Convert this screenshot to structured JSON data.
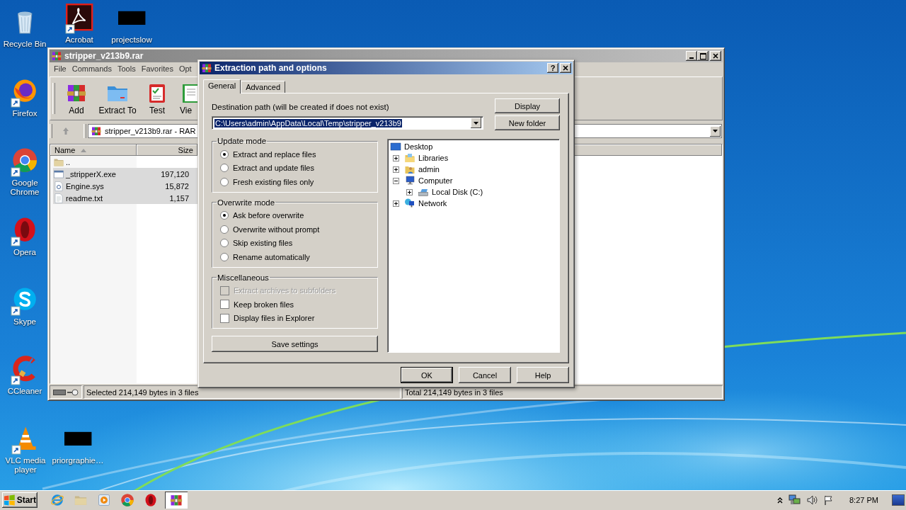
{
  "desktop_icons": [
    {
      "label": "Recycle Bin",
      "kind": "recycle_bin",
      "shortcut": false
    },
    {
      "label": "Acrobat",
      "kind": "acrobat",
      "shortcut": true
    },
    {
      "label": "projectslow",
      "kind": "thumbnail",
      "shortcut": false
    },
    {
      "label": "Firefox",
      "kind": "firefox",
      "shortcut": true
    },
    {
      "label": "Google Chrome",
      "kind": "chrome",
      "shortcut": true
    },
    {
      "label": "Opera",
      "kind": "opera",
      "shortcut": true
    },
    {
      "label": "Skype",
      "kind": "skype",
      "shortcut": true
    },
    {
      "label": "CCleaner",
      "kind": "ccleaner",
      "shortcut": true
    },
    {
      "label": "VLC media player",
      "kind": "vlc",
      "shortcut": true
    },
    {
      "label": "priorgraphie…",
      "kind": "thumbnail",
      "shortcut": false
    }
  ],
  "archive_window": {
    "title": "stripper_v213b9.rar",
    "menu": [
      "File",
      "Commands",
      "Tools",
      "Favorites",
      "Opt"
    ],
    "toolbar": [
      {
        "label": "Add",
        "kind": "add"
      },
      {
        "label": "Extract To",
        "kind": "extract"
      },
      {
        "label": "Test",
        "kind": "test"
      },
      {
        "label": "Vie",
        "kind": "view"
      }
    ],
    "address": "stripper_v213b9.rar - RAR",
    "columns": [
      "Name",
      "Size"
    ],
    "files": [
      {
        "name": "..",
        "kind": "up_folder",
        "selected": false
      },
      {
        "name": "_stripperX.exe",
        "size": "197,120",
        "kind": "exe",
        "selected": true
      },
      {
        "name": "Engine.sys",
        "size": "15,872",
        "kind": "sys",
        "selected": true
      },
      {
        "name": "readme.txt",
        "size": "1,157",
        "kind": "txt",
        "selected": true
      }
    ],
    "status_selected": "Selected 214,149 bytes in 3 files",
    "status_total": "Total 214,149 bytes in 3 files"
  },
  "dialog": {
    "title": "Extraction path and options",
    "help_button": "?",
    "tabs": [
      {
        "label": "General",
        "selected": true
      },
      {
        "label": "Advanced",
        "selected": false
      }
    ],
    "destination_label": "Destination path (will be created if does not exist)",
    "destination_path": "C:\\Users\\admin\\AppData\\Local\\Temp\\stripper_v213b9",
    "side_buttons": [
      "Display",
      "New folder"
    ],
    "groups": [
      {
        "title": "Update mode",
        "options": [
          {
            "label": "Extract and replace files",
            "kind": "radio",
            "selected": true,
            "disabled": false
          },
          {
            "label": "Extract and update files",
            "kind": "radio",
            "selected": false,
            "disabled": false
          },
          {
            "label": "Fresh existing files only",
            "kind": "radio",
            "selected": false,
            "disabled": false
          }
        ]
      },
      {
        "title": "Overwrite mode",
        "options": [
          {
            "label": "Ask before overwrite",
            "kind": "radio",
            "selected": true,
            "disabled": false
          },
          {
            "label": "Overwrite without prompt",
            "kind": "radio",
            "selected": false,
            "disabled": false
          },
          {
            "label": "Skip existing files",
            "kind": "radio",
            "selected": false,
            "disabled": false
          },
          {
            "label": "Rename automatically",
            "kind": "radio",
            "selected": false,
            "disabled": false
          }
        ]
      },
      {
        "title": "Miscellaneous",
        "options": [
          {
            "label": "Extract archives to subfolders",
            "kind": "checkbox",
            "checked": false,
            "disabled": true
          },
          {
            "label": "Keep broken files",
            "kind": "checkbox",
            "checked": false,
            "disabled": false
          },
          {
            "label": "Display files in Explorer",
            "kind": "checkbox",
            "checked": false,
            "disabled": false
          }
        ]
      }
    ],
    "save_button": "Save settings",
    "tree": [
      {
        "label": "Desktop",
        "kind": "desktop",
        "children": [
          {
            "label": "Libraries",
            "kind": "libraries",
            "expanded": false
          },
          {
            "label": "admin",
            "kind": "user",
            "expanded": false
          },
          {
            "label": "Computer",
            "kind": "computer",
            "expanded": true,
            "children": [
              {
                "label": "Local Disk (C:)",
                "kind": "drive",
                "expanded": false
              }
            ]
          },
          {
            "label": "Network",
            "kind": "network",
            "expanded": false
          }
        ]
      }
    ],
    "buttons": [
      {
        "label": "OK",
        "default": true
      },
      {
        "label": "Cancel",
        "default": false
      },
      {
        "label": "Help",
        "default": false
      }
    ]
  },
  "taskbar": {
    "start": "Start",
    "apps": [
      {
        "kind": "ie",
        "selected": false
      },
      {
        "kind": "explorer",
        "selected": false
      },
      {
        "kind": "media",
        "selected": false
      },
      {
        "kind": "chrome",
        "selected": false
      },
      {
        "kind": "opera",
        "selected": false
      },
      {
        "kind": "winrar",
        "selected": true
      }
    ],
    "clock": "8:27 PM"
  }
}
